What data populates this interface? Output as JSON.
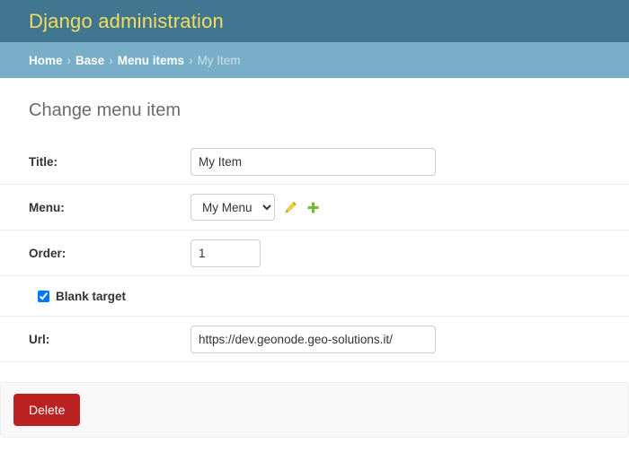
{
  "header": {
    "site_title": "Django administration",
    "background_color": "#417690",
    "title_color": "#f5dd5d"
  },
  "breadcrumbs": {
    "background_color": "#79aec8",
    "separator": "›",
    "items": [
      {
        "label": "Home",
        "current": false
      },
      {
        "label": "Base",
        "current": false
      },
      {
        "label": "Menu items",
        "current": false
      },
      {
        "label": "My Item",
        "current": true
      }
    ]
  },
  "main": {
    "page_title": "Change menu item"
  },
  "form": {
    "title_field": {
      "label": "Title:",
      "value": "My Item",
      "placeholder": ""
    },
    "menu_field": {
      "label": "Menu:",
      "selected": "My Menu",
      "options": [
        "My Menu"
      ],
      "edit_icon": "pencil-icon",
      "edit_icon_color": "#efb80b",
      "add_icon": "plus-icon",
      "add_icon_color": "#70bf2b"
    },
    "order_field": {
      "label": "Order:",
      "value": "1",
      "placeholder": ""
    },
    "blank_target_field": {
      "label": "Blank target",
      "checked": true
    },
    "url_field": {
      "label": "Url:",
      "value": "https://dev.geonode.geo-solutions.it/",
      "placeholder": ""
    }
  },
  "submit_row": {
    "delete_label": "Delete",
    "delete_color": "#ba2121",
    "background_color": "#f8f8f8"
  }
}
